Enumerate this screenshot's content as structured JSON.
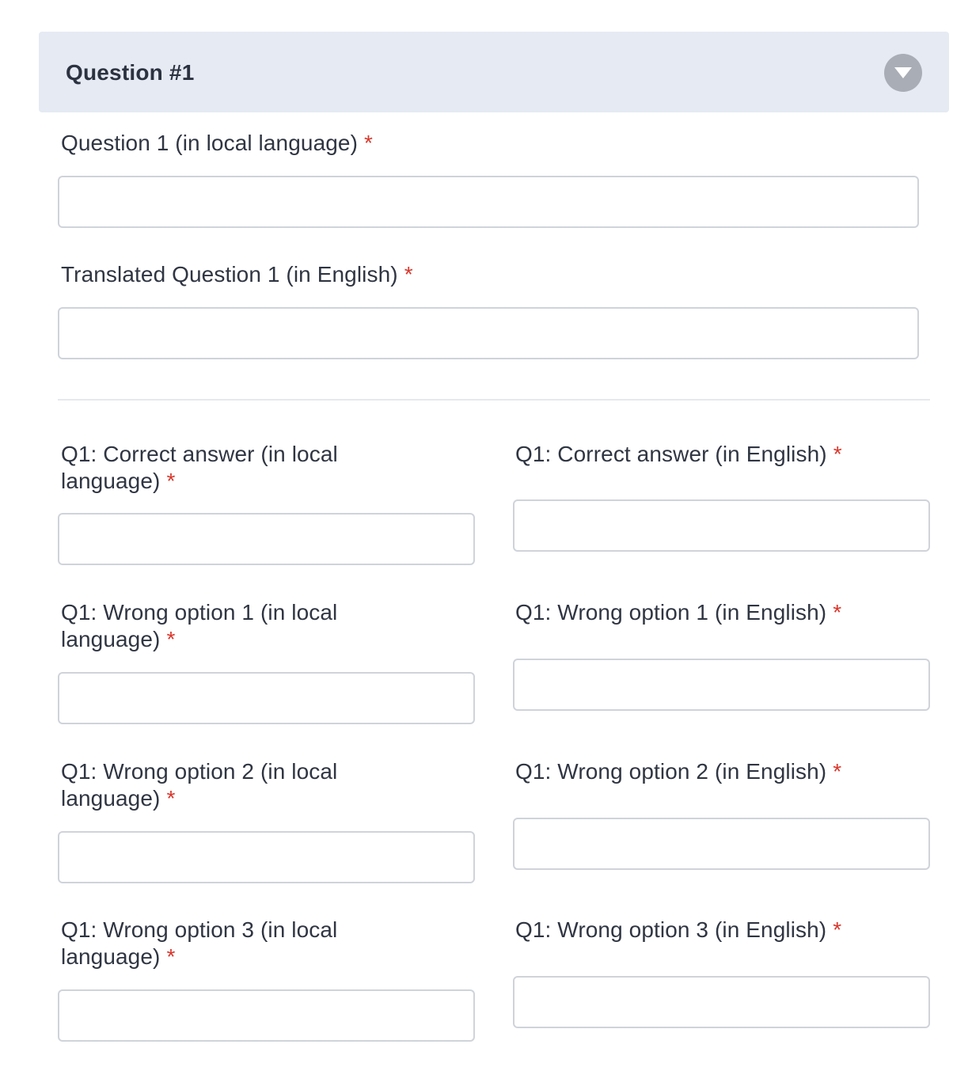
{
  "header": {
    "title": "Question #1",
    "toggle_icon": "chevron-down-icon"
  },
  "fields": {
    "question_local": {
      "label": "Question 1 (in local language)",
      "required_mark": "*",
      "value": "",
      "placeholder": ""
    },
    "question_english": {
      "label": "Translated Question 1 (in English)",
      "required_mark": "*",
      "value": "",
      "placeholder": ""
    },
    "correct_local": {
      "label": "Q1: Correct answer (in local",
      "label_cont": "language)",
      "required_mark": "*",
      "value": ""
    },
    "correct_english": {
      "label": "Q1: Correct answer (in English)",
      "required_mark": "*",
      "value": ""
    },
    "wrong1_local": {
      "label": "Q1: Wrong option 1 (in local",
      "label_cont": "language)",
      "required_mark": "*",
      "value": ""
    },
    "wrong1_english": {
      "label": "Q1: Wrong option 1 (in English)",
      "required_mark": "*",
      "value": ""
    },
    "wrong2_local": {
      "label": "Q1: Wrong option 2 (in local",
      "label_cont": "language)",
      "required_mark": "*",
      "value": ""
    },
    "wrong2_english": {
      "label": "Q1: Wrong option 2 (in English)",
      "required_mark": "*",
      "value": ""
    },
    "wrong3_local": {
      "label": "Q1: Wrong option 3 (in local",
      "label_cont": "language)",
      "required_mark": "*",
      "value": ""
    },
    "wrong3_english": {
      "label": "Q1: Wrong option 3 (in English)",
      "required_mark": "*",
      "value": ""
    }
  },
  "colors": {
    "header_bg": "#e5eaf3",
    "required": "#d9362b",
    "input_border": "#cfd3da",
    "toggle_bg": "#a9adb5"
  }
}
